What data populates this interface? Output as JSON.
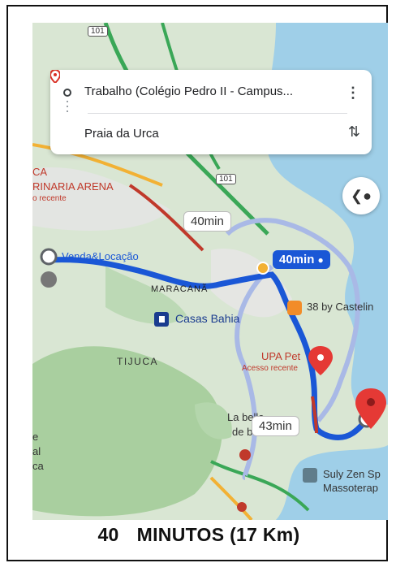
{
  "search_card": {
    "origin": "Trabalho (Colégio Pedro II - Campus...",
    "destination": "Praia da Urca",
    "more_icon": "more-vert-icon",
    "swap_icon": "swap-vert-icon"
  },
  "map": {
    "road_shield_top": "101",
    "road_shield_mid": "101",
    "arena_line1": "CA",
    "arena_line2": "RINARIA ARENA",
    "arena_sub": "o recente",
    "venda": "Venda&Locação",
    "maracana": "MARACANÃ",
    "casas_bahia": "Casas Bahia",
    "tijuca": "TIJUCA",
    "restaurant": "38 by Castelin",
    "upa": "UPA Pet",
    "upa_sub": "Acesso recente",
    "labelle_1": "La belle",
    "labelle_2": "de beleza",
    "suly_1": "Suly Zen Sp",
    "suly_2": "Massoterap",
    "left_e": "e",
    "left_al": "al",
    "left_ca": "ca"
  },
  "route_bubbles": {
    "main": "40min",
    "alt_top": "40min",
    "alt_bottom": "43min"
  },
  "footer": {
    "minutes": "40",
    "text": "MINUTOS (17 Km)"
  },
  "colors": {
    "route_main": "#1a57d6",
    "route_alt": "#a9b9e6",
    "water": "#9fcfe8",
    "park": "#bcd9b5",
    "destination_pin": "#e53935"
  }
}
